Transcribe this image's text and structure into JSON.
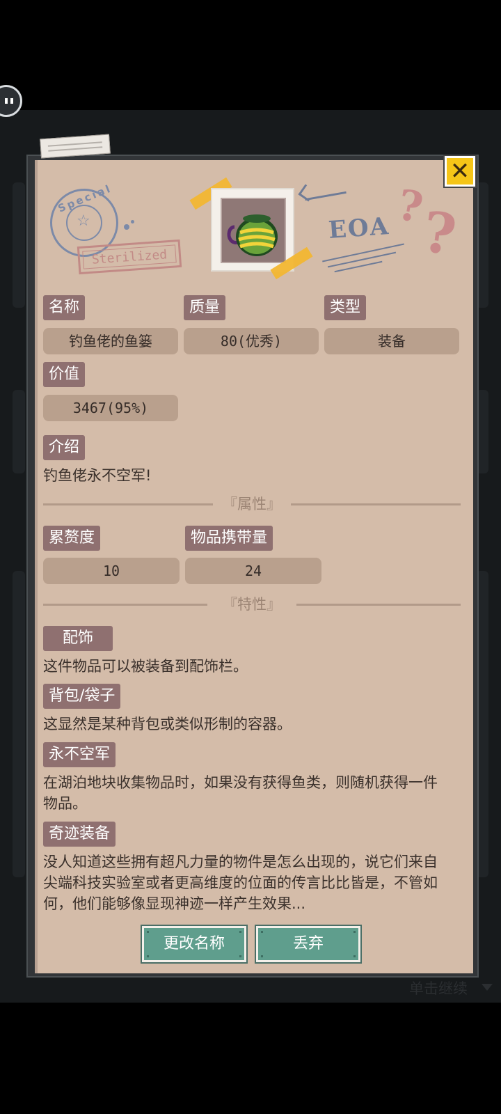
{
  "item": {
    "name_label": "名称",
    "name": "钓鱼佬的鱼篓",
    "quality_label": "质量",
    "quality": "80(优秀)",
    "type_label": "类型",
    "type": "装备",
    "value_label": "价值",
    "value": "3467(95%)",
    "intro_label": "介绍",
    "intro": "钓鱼佬永不空军!"
  },
  "attributes": {
    "section_title": "『属性』",
    "burden_label": "累赘度",
    "burden": "10",
    "capacity_label": "物品携带量",
    "capacity": "24"
  },
  "traits": {
    "section_title": "『特性』",
    "items": [
      {
        "label": "配饰",
        "desc": "这件物品可以被装备到配饰栏。"
      },
      {
        "label": "背包/袋子",
        "desc": "这显然是某种背包或类似形制的容器。"
      },
      {
        "label": "永不空军",
        "desc": "在湖泊地块收集物品时，如果没有获得鱼类，则随机获得一件物品。"
      },
      {
        "label": "奇迹装备",
        "desc": "没人知道这些拥有超凡力量的物件是怎么出现的，说它们来自尖端科技实验室或者更高维度的位面的传言比比皆是，不管如何，他们能够像显现神迹一样产生效果..."
      }
    ]
  },
  "buttons": {
    "rename": "更改名称",
    "discard": "丢弃"
  },
  "stamps": {
    "special": "Special",
    "sterilized": "Sterilized",
    "eoa": "EOA",
    "marks": "??"
  },
  "continue_hint": "单击继续",
  "icons": {
    "close": "close-icon",
    "pause": "pause-icon",
    "item": "fish-basket-icon"
  },
  "colors": {
    "panel": "#d4bca9",
    "label_bg": "#8f7070",
    "value_bg": "#b9a08d",
    "button": "#5f9e8d",
    "close": "#f5c518"
  }
}
